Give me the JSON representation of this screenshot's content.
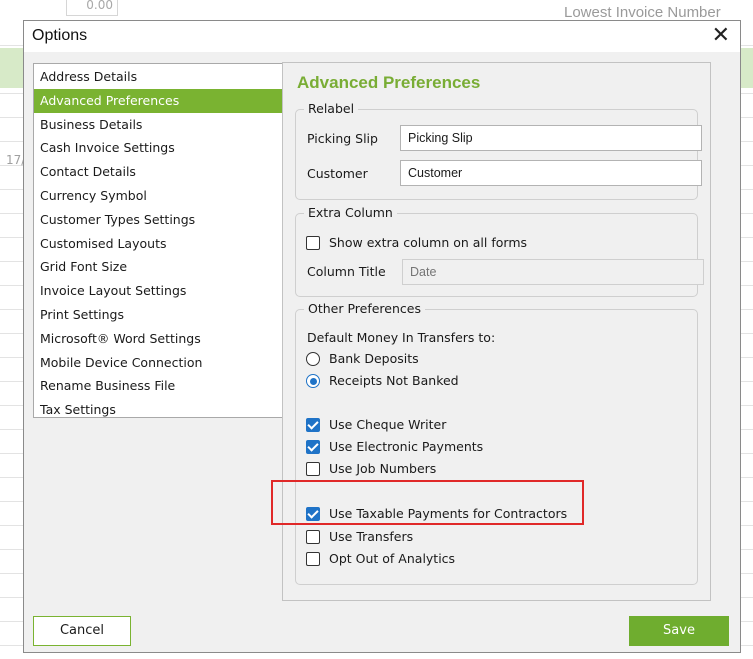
{
  "background": {
    "amount_value": "0.00",
    "lowest_invoice_label": "Lowest Invoice Number",
    "partial_date": "17/"
  },
  "dialog": {
    "title": "Options",
    "close_glyph": "✕"
  },
  "nav": {
    "selected_index": 1,
    "items": [
      {
        "label": "Address Details"
      },
      {
        "label": "Advanced Preferences"
      },
      {
        "label": "Business Details"
      },
      {
        "label": "Cash Invoice Settings"
      },
      {
        "label": "Contact Details"
      },
      {
        "label": "Currency Symbol"
      },
      {
        "label": "Customer Types Settings"
      },
      {
        "label": "Customised Layouts"
      },
      {
        "label": "Grid Font Size"
      },
      {
        "label": "Invoice Layout Settings"
      },
      {
        "label": "Print Settings"
      },
      {
        "label": "Microsoft® Word Settings"
      },
      {
        "label": "Mobile Device Connection"
      },
      {
        "label": "Rename Business File"
      },
      {
        "label": "Tax Settings"
      }
    ]
  },
  "panel": {
    "title": "Advanced Preferences",
    "relabel": {
      "group_label": "Relabel",
      "picking_slip_label": "Picking Slip",
      "picking_slip_value": "Picking Slip",
      "customer_label": "Customer",
      "customer_value": "Customer"
    },
    "extra_column": {
      "group_label": "Extra Column",
      "show_extra_label": "Show extra column on all forms",
      "show_extra_checked": false,
      "column_title_label": "Column Title",
      "column_title_placeholder": "Date"
    },
    "other": {
      "group_label": "Other Preferences",
      "money_in_label": "Default Money In Transfers to:",
      "radio_bank_deposits": "Bank Deposits",
      "radio_receipts_not_banked": "Receipts Not Banked",
      "selected_radio": "Receipts Not Banked",
      "use_cheque_writer": "Use Cheque Writer",
      "use_cheque_writer_checked": true,
      "use_electronic_payments": "Use Electronic Payments",
      "use_electronic_payments_checked": true,
      "use_job_numbers": "Use Job Numbers",
      "use_job_numbers_checked": false,
      "use_taxable_payments": "Use Taxable Payments for Contractors",
      "use_taxable_payments_checked": true,
      "use_transfers": "Use Transfers",
      "use_transfers_checked": false,
      "opt_out_analytics": "Opt Out of Analytics",
      "opt_out_analytics_checked": false
    }
  },
  "buttons": {
    "cancel_label": "Cancel",
    "save_label": "Save"
  },
  "colors": {
    "accent_green": "#7ab331",
    "check_blue": "#1f73c7",
    "highlight_red": "#e02828"
  }
}
